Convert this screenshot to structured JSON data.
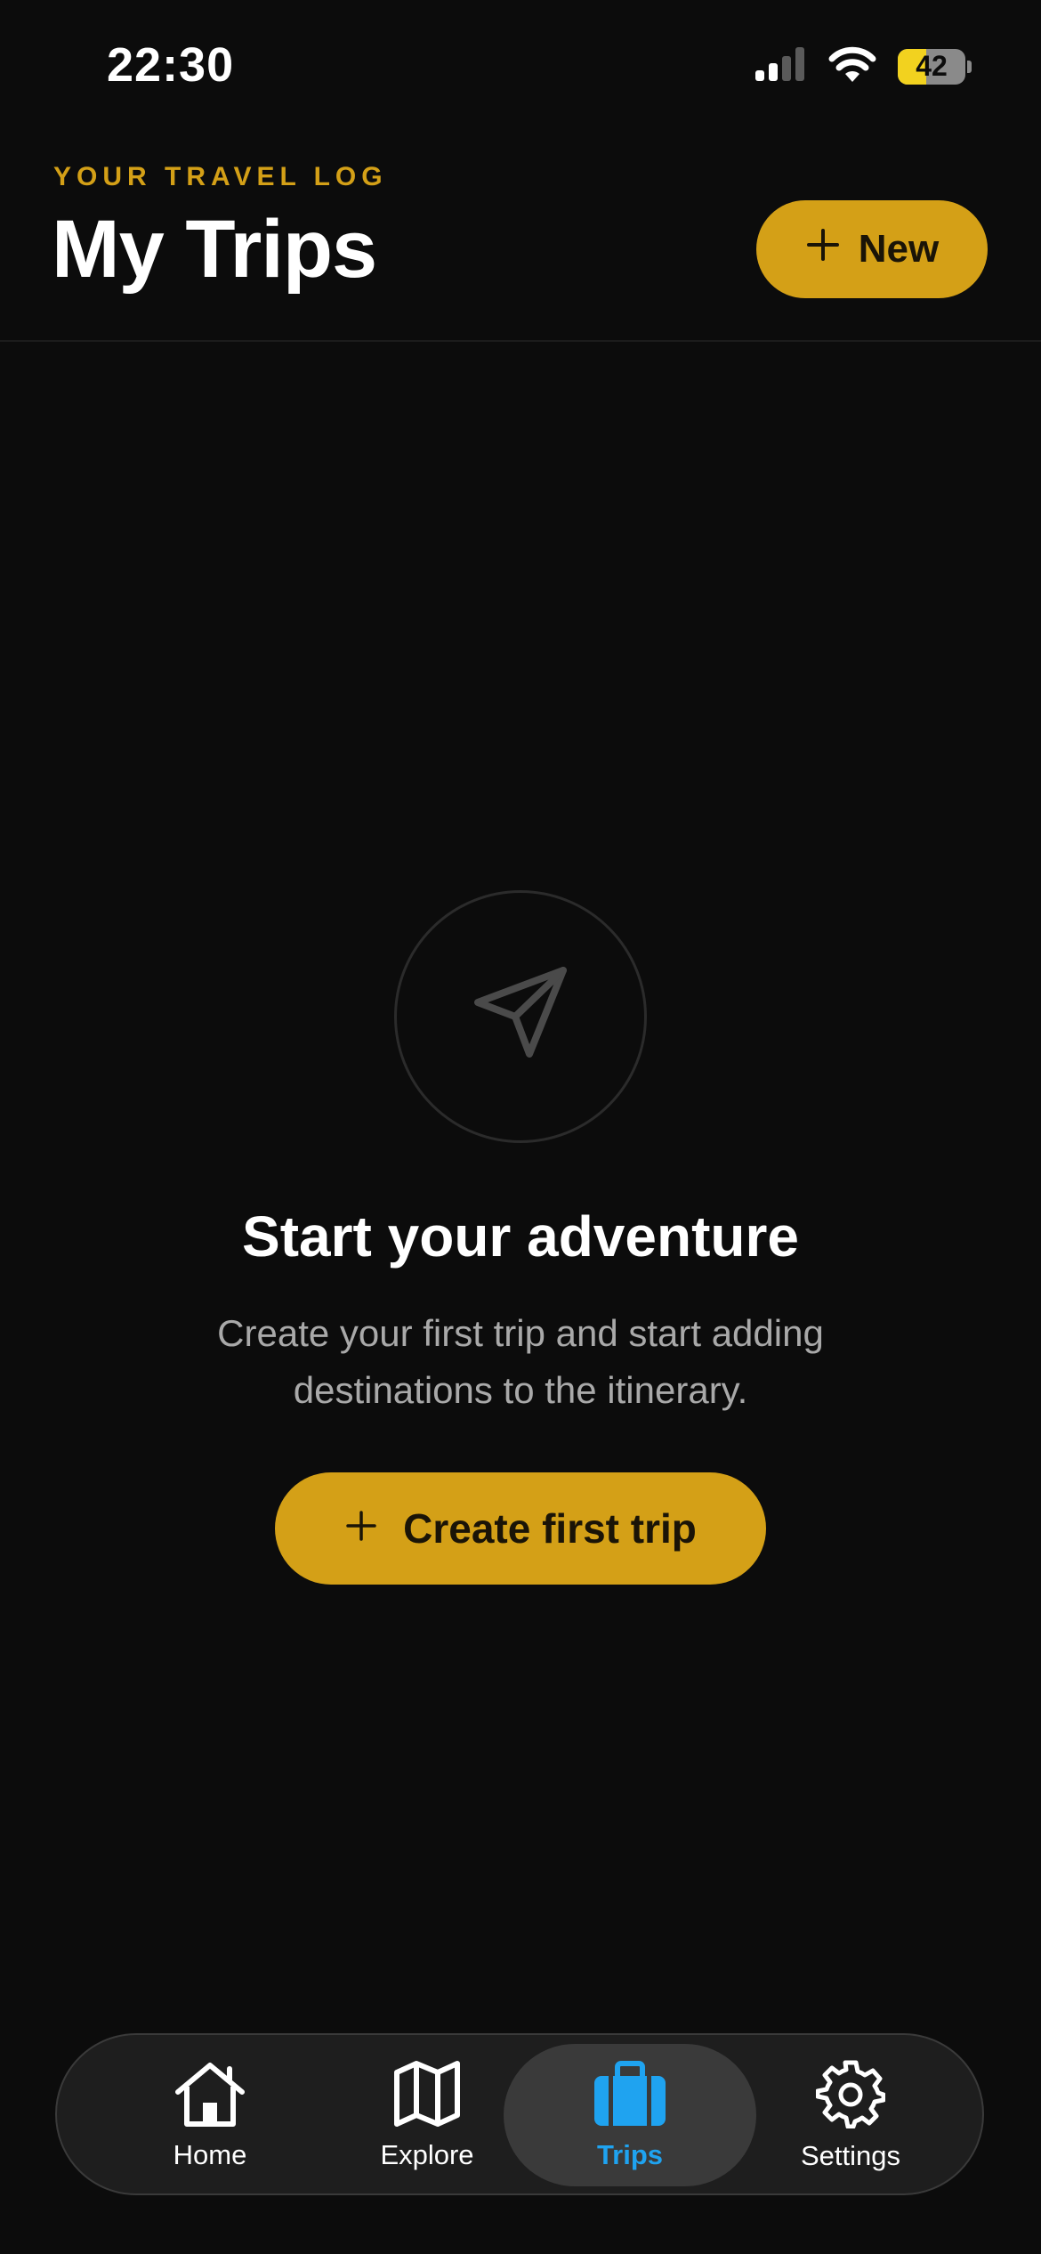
{
  "status_bar": {
    "time": "22:30",
    "battery_level": "42",
    "battery_fraction": 0.42,
    "icons": [
      "cellular-signal-icon",
      "wifi-icon",
      "battery-icon"
    ]
  },
  "header": {
    "eyebrow": "YOUR TRAVEL LOG",
    "title": "My Trips",
    "new_button_label": "New"
  },
  "empty_state": {
    "icon": "paper-plane-icon",
    "title": "Start your adventure",
    "description": "Create your first trip and start adding destinations to the itinerary.",
    "button_label": "Create first trip"
  },
  "tab_bar": {
    "tabs": [
      {
        "label": "Home",
        "icon": "home-icon",
        "active": false
      },
      {
        "label": "Explore",
        "icon": "map-icon",
        "active": false
      },
      {
        "label": "Trips",
        "icon": "suitcase-icon",
        "active": true
      },
      {
        "label": "Settings",
        "icon": "gear-icon",
        "active": false
      }
    ]
  },
  "colors": {
    "background": "#0c0c0c",
    "accent": "#d4a017",
    "active_tab": "#1fa3f0",
    "battery": "#f2d21f"
  }
}
